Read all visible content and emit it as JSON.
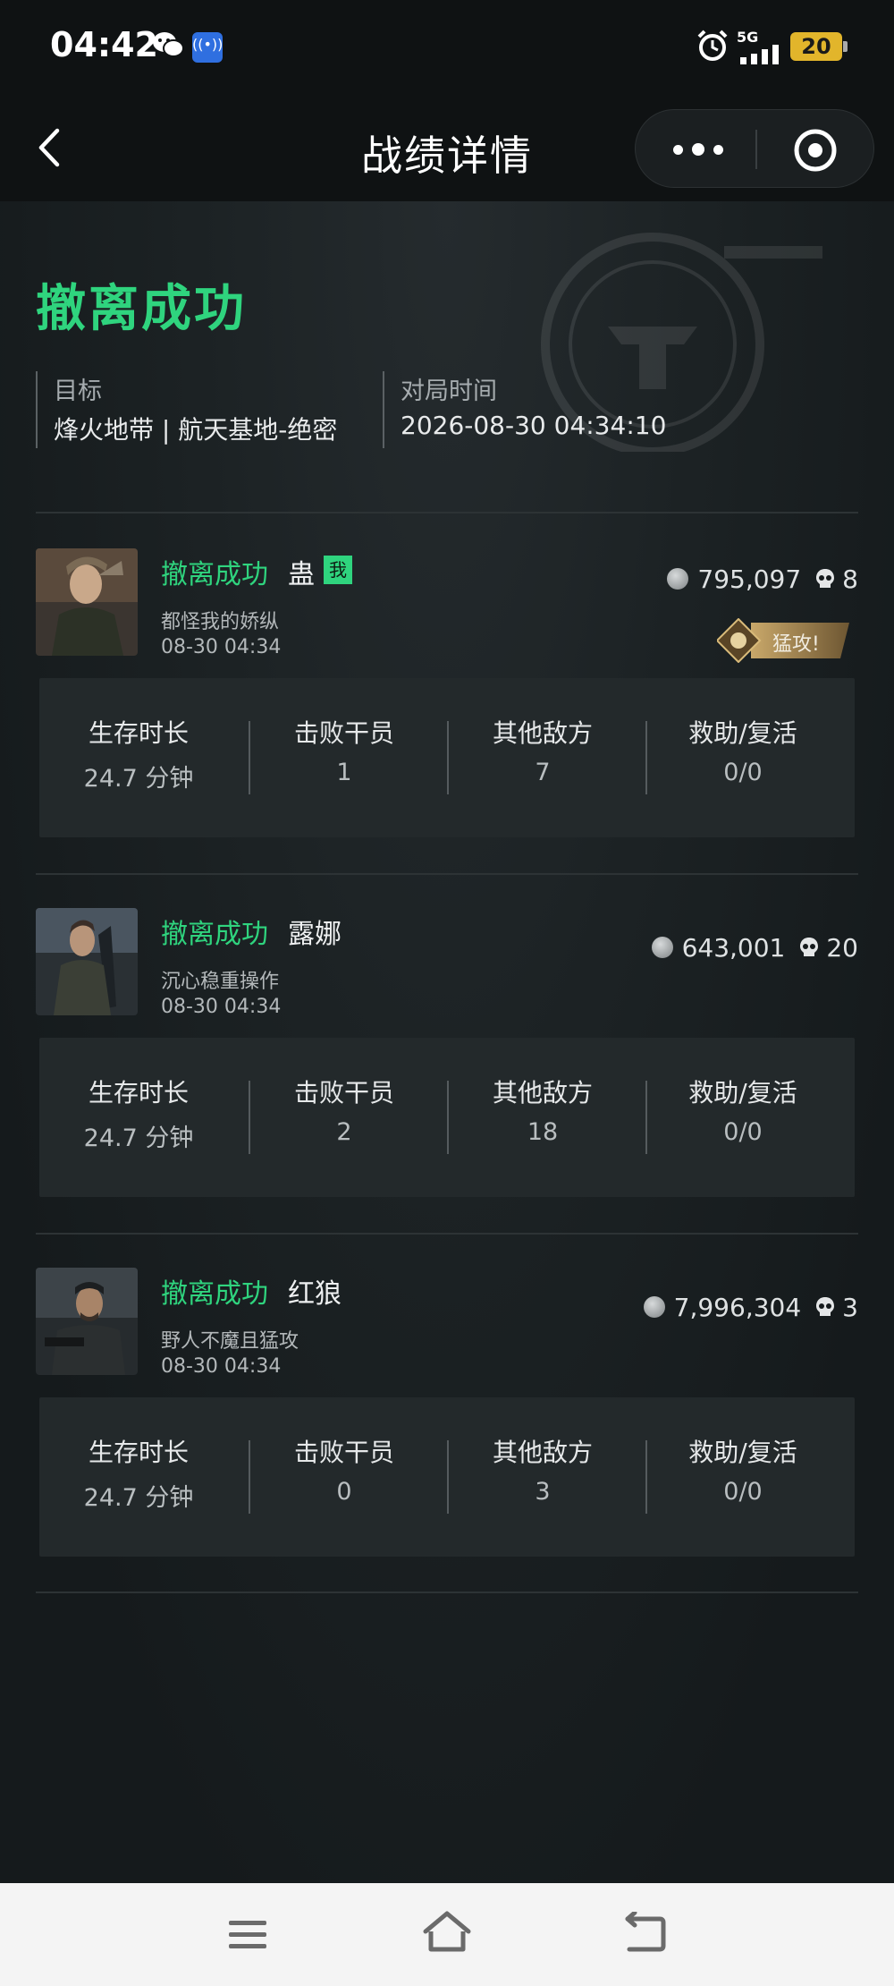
{
  "status_bar": {
    "time": "04:42",
    "network": "5G",
    "battery": "20",
    "radio_badge": "((•))",
    "icons": [
      "wechat-icon",
      "radio-icon",
      "alarm-icon",
      "signal-icon",
      "battery-icon"
    ]
  },
  "navbar": {
    "title": "战绩详情",
    "icons": [
      "back-chevron-icon",
      "more-dots-icon",
      "target-circle-icon"
    ]
  },
  "summary": {
    "result": "撤离成功",
    "target_label": "目标",
    "target_value": "烽火地带 | 航天基地-绝密",
    "time_label": "对局时间",
    "time_value": "2026-08-30 04:34:10"
  },
  "stat_labels": [
    "生存时长",
    "击败干员",
    "其他敌方",
    "救助/复活"
  ],
  "players": [
    {
      "status": "撤离成功",
      "name": "蛊",
      "me_tag": "我",
      "motto": "都怪我的娇纵",
      "time": "08-30 04:34",
      "value": "795,097",
      "kills": "8",
      "badge": "猛攻!",
      "stats": [
        "24.7 分钟",
        "1",
        "7",
        "0/0"
      ]
    },
    {
      "status": "撤离成功",
      "name": "露娜",
      "motto": "沉心稳重操作",
      "time": "08-30 04:34",
      "value": "643,001",
      "kills": "20",
      "stats": [
        "24.7 分钟",
        "2",
        "18",
        "0/0"
      ]
    },
    {
      "status": "撤离成功",
      "name": "红狼",
      "motto": "野人不魔且猛攻",
      "time": "08-30 04:34",
      "value": "7,996,304",
      "kills": "3",
      "stats": [
        "24.7 分钟",
        "0",
        "3",
        "0/0"
      ]
    }
  ],
  "colors": {
    "accent_green": "#2fd47e",
    "background": "#151a1c",
    "card": "#23292b",
    "badge_gold": "#9b7a3e"
  },
  "bottom_nav": {
    "icons": [
      "menu-icon",
      "home-icon",
      "back-icon"
    ]
  }
}
